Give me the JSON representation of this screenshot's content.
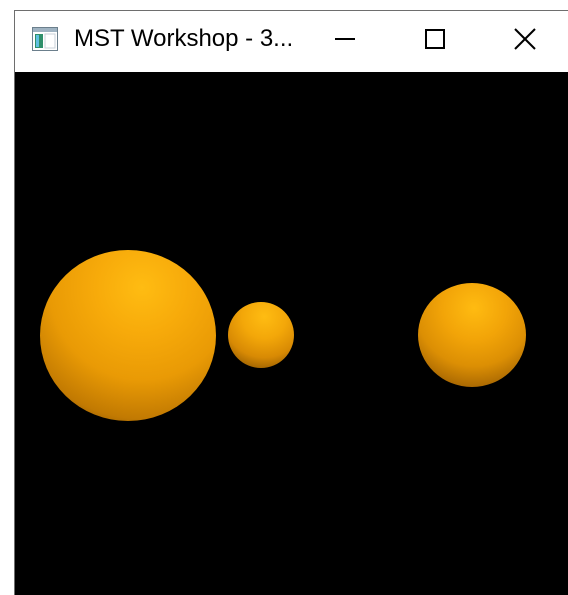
{
  "window": {
    "title": "MST Workshop - 3...",
    "icons": {
      "app": "app-window-icon",
      "minimize": "minimize-icon",
      "maximize": "maximize-icon",
      "close": "close-icon"
    }
  },
  "scene": {
    "background_color": "#000000",
    "sphere_color": "#f5a30a",
    "objects": [
      "large-sphere",
      "small-sphere",
      "medium-sphere"
    ]
  }
}
